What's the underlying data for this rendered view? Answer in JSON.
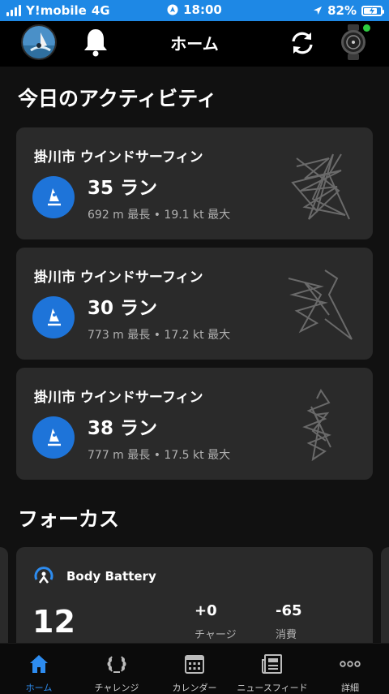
{
  "status_bar": {
    "carrier": "Y!mobile",
    "network": "4G",
    "time": "18:00",
    "battery": "82%",
    "battery_level": 0.82
  },
  "header": {
    "title": "ホーム"
  },
  "activities": {
    "title": "今日のアクティビティ",
    "items": [
      {
        "title": "掛川市 ウインドサーフィン",
        "runs": "35 ラン",
        "stats": "692 m 最長 • 19.1 kt 最大"
      },
      {
        "title": "掛川市 ウインドサーフィン",
        "runs": "30 ラン",
        "stats": "773 m 最長 • 17.2 kt 最大"
      },
      {
        "title": "掛川市 ウインドサーフィン",
        "runs": "38 ラン",
        "stats": "777 m 最長 • 17.5 kt 最大"
      }
    ]
  },
  "focus": {
    "title": "フォーカス",
    "body_battery": {
      "title": "Body Battery",
      "value": "12",
      "charge": "+0",
      "charge_label": "チャージ",
      "drain": "-65",
      "drain_label": "消費"
    }
  },
  "nav": {
    "items": [
      {
        "label": "ホーム",
        "icon": "home-icon",
        "active": true
      },
      {
        "label": "チャレンジ",
        "icon": "laurel-icon",
        "active": false
      },
      {
        "label": "カレンダー",
        "icon": "calendar-icon",
        "active": false
      },
      {
        "label": "ニュースフィード",
        "icon": "news-icon",
        "active": false
      },
      {
        "label": "詳細",
        "icon": "more-icon",
        "active": false
      }
    ]
  },
  "colors": {
    "accent": "#1e88e5",
    "activity_icon_bg": "#1e74d9",
    "nav_active": "#2d8cf0",
    "card_bg": "#2a2a2a"
  }
}
